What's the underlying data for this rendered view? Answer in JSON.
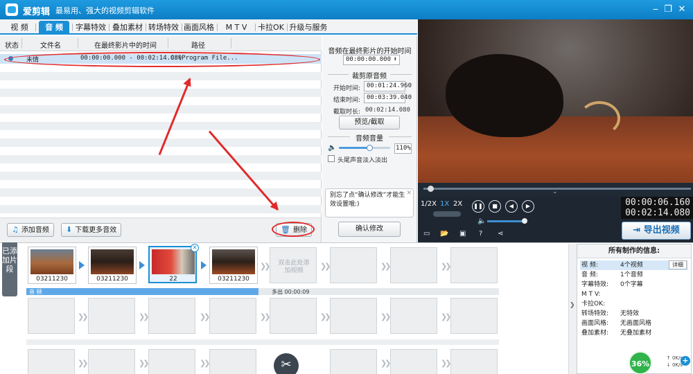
{
  "app": {
    "name": "爱剪辑",
    "slogan": "最易用、强大的视频剪辑软件"
  },
  "window_controls": [
    "minimize",
    "maximize",
    "close"
  ],
  "tabs": [
    "视 频",
    "音 频",
    "字幕特效",
    "叠加素材",
    "转场特效",
    "画面风格",
    "M T V",
    "卡拉OK",
    "升级与服务"
  ],
  "active_tab": "音 频",
  "list": {
    "headers": [
      "状态",
      "文件名",
      "在最终影片中的时间",
      "路径"
    ],
    "rows": [
      {
        "filename": "未情",
        "time": "00:00:00.000 - 00:02:14.080",
        "path": "C:\\Program File..."
      }
    ]
  },
  "bottom_buttons": {
    "add_audio": "添加音频",
    "download_more": "下载更多音效",
    "delete": "删除"
  },
  "edit": {
    "start_title": "音频在最终影片的开始时间",
    "start_value": "00:00:00.000",
    "crop_title": "裁剪原音频",
    "start_label": "开始时间:",
    "start_time": "00:01:24.960",
    "end_label": "结束时间:",
    "end_time": "00:03:39.040",
    "len_label": "截取时长:",
    "len_value": "00:02:14.080",
    "preview_btn": "预览/截取",
    "volume_title": "音频音量",
    "volume_value": "110%",
    "volume_level": 0.6,
    "fade_label": "头尾声音淡入淡出",
    "confirm_btn": "确认修改",
    "tip": "别忘了点“确认修改”才能生效设置哦:)"
  },
  "player": {
    "speeds": [
      "1/2X",
      "1X",
      "2X"
    ],
    "active_speed": "1X",
    "time_current": "00:00:06.160",
    "time_total": "00:02:14.080",
    "export_btn": "导出视频"
  },
  "timeline": {
    "side_tab": "已添加片段",
    "clips": [
      {
        "label": "03211230"
      },
      {
        "label": "03211230"
      },
      {
        "label": "22"
      },
      {
        "label": "03211230"
      }
    ],
    "add_hint": "双击此处添加视频",
    "audio_track_label": "音 频",
    "audio_extra": "多出 00:00:09"
  },
  "info": {
    "title": "所有制作的信息:",
    "rows": [
      {
        "k": "视  频:",
        "v": "4个视频",
        "btn": "详细"
      },
      {
        "k": "音  频:",
        "v": "1个音频"
      },
      {
        "k": "字幕特效:",
        "v": "0个字幕"
      },
      {
        "k": "M  T  V:",
        "v": ""
      },
      {
        "k": "卡拉OK:",
        "v": ""
      },
      {
        "k": "转场特效:",
        "v": "无特效"
      },
      {
        "k": "画面风格:",
        "v": "无画面风格"
      },
      {
        "k": "叠加素材:",
        "v": "无叠加素材"
      }
    ]
  },
  "status": {
    "cpu": "36%",
    "up": "0K/s",
    "down": "0K/s"
  }
}
